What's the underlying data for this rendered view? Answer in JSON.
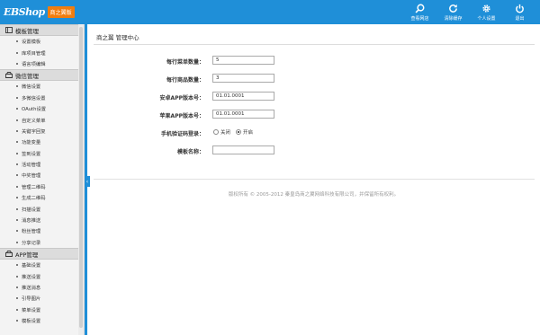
{
  "brand": {
    "logo_text": "EBShop",
    "badge": "商之翼版"
  },
  "header_actions": [
    {
      "label": "查看网店",
      "icon": "search-icon"
    },
    {
      "label": "清除缓存",
      "icon": "refresh-icon"
    },
    {
      "label": "个人设置",
      "icon": "gear-icon"
    },
    {
      "label": "退出",
      "icon": "power-icon"
    }
  ],
  "sidebar": {
    "groups": [
      {
        "title": "模板管理",
        "icon": "template-icon",
        "items": [
          "设置模板",
          "库项目管理",
          "语言项编辑"
        ]
      },
      {
        "title": "微信管理",
        "icon": "wechat-icon",
        "items": [
          "微信设置",
          "多微信设置",
          "OAuth设置",
          "自定义菜单",
          "关键字回复",
          "功能变量",
          "签到设置",
          "活动管理",
          "中奖管理",
          "管理二维码",
          "生成二维码",
          "扫描设置",
          "消息推送",
          "粉丝管理",
          "分享记录"
        ]
      },
      {
        "title": "APP管理",
        "icon": "app-icon",
        "items": [
          "基础设置",
          "推送设置",
          "推送消息",
          "引导图片",
          "菜单设置",
          "模板设置"
        ]
      }
    ]
  },
  "breadcrumb": {
    "text": "商之翼  管理中心"
  },
  "form": {
    "menu_per_row": {
      "label": "每行菜单数量：",
      "value": "5"
    },
    "goods_per_row": {
      "label": "每行商品数量：",
      "value": "3"
    },
    "android_version": {
      "label": "安卓APP版本号：",
      "value": "01.01.0001"
    },
    "iphone_version": {
      "label": "苹果APP版本号：",
      "value": "01.01.0001"
    },
    "sms_login": {
      "label": "手机验证码登录：",
      "option_off": "关闭",
      "option_on": "开启",
      "selected": "开启"
    },
    "template_name": {
      "label": "模板名称：",
      "value": ""
    }
  },
  "footer": {
    "text": "版权所有 © 2005-2012 秦皇岛商之翼网络科技有限公司，并保留所有权利。"
  },
  "colors": {
    "primary": "#1f8fd8",
    "badge": "#f07d0f"
  }
}
